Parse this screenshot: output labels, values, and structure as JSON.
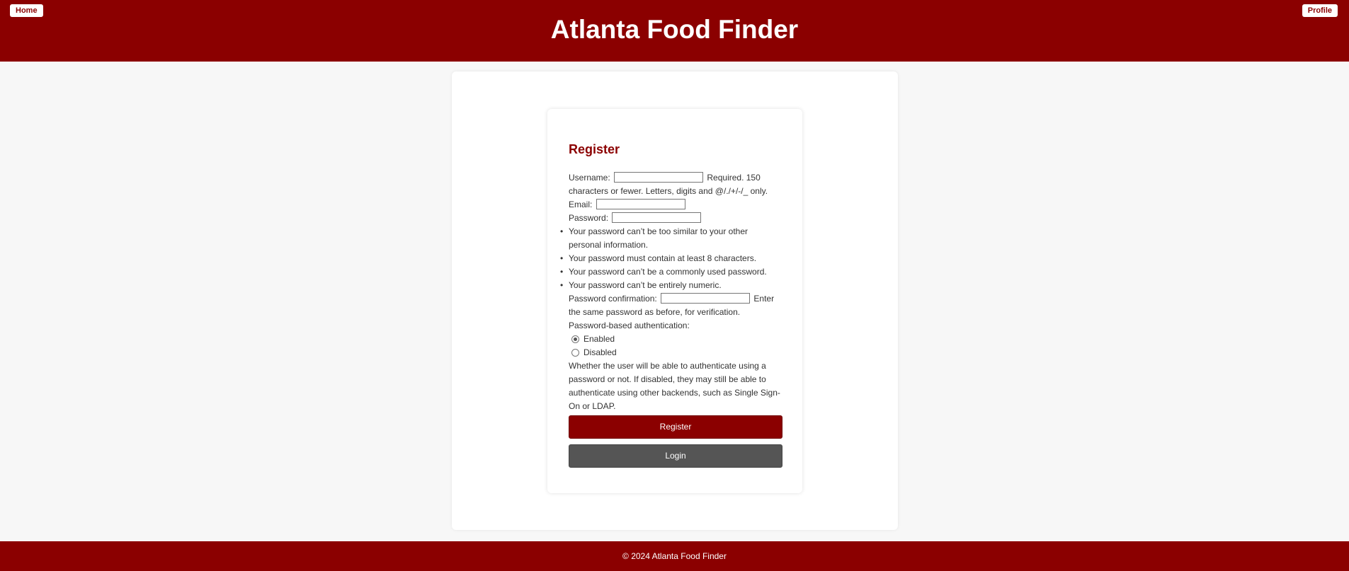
{
  "header": {
    "title": "Atlanta Food Finder",
    "home_label": "Home",
    "profile_label": "Profile"
  },
  "form": {
    "title": "Register",
    "username_label": "Username:",
    "username_help": "Required. 150 characters or fewer. Letters, digits and @/./+/-/_ only.",
    "email_label": "Email:",
    "password_label": "Password:",
    "password_rules": [
      "Your password can’t be too similar to your other personal information.",
      "Your password must contain at least 8 characters.",
      "Your password can’t be a commonly used password.",
      "Your password can’t be entirely numeric."
    ],
    "password_confirm_label": "Password confirmation:",
    "password_confirm_help": "Enter the same password as before, for verification.",
    "auth_label": "Password-based authentication:",
    "auth_options": [
      {
        "label": "Enabled",
        "selected": true
      },
      {
        "label": "Disabled",
        "selected": false
      }
    ],
    "auth_help": "Whether the user will be able to authenticate using a password or not. If disabled, they may still be able to authenticate using other backends, such as Single Sign-On or LDAP.",
    "register_label": "Register",
    "login_label": "Login"
  },
  "footer": {
    "text": "© 2024 Atlanta Food Finder"
  },
  "colors": {
    "brand": "#8b0000",
    "secondary_button": "#555555"
  }
}
